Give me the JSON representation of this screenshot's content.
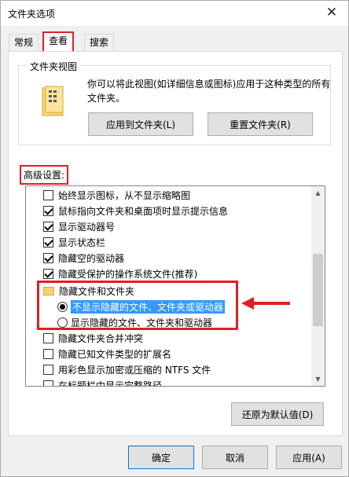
{
  "window": {
    "title": "文件夹选项",
    "close_glyph": "✕"
  },
  "tabs": [
    {
      "label": "常规"
    },
    {
      "label": "查看"
    },
    {
      "label": "搜索"
    }
  ],
  "folder_views": {
    "title": "文件夹视图",
    "description": "你可以将此视图(如详细信息或图标)应用于这种类型的所有文件夹。",
    "apply_button": "应用到文件夹(L)",
    "reset_button": "重置文件夹(R)"
  },
  "advanced": {
    "label": "高级设置:",
    "items": [
      {
        "label": "始终显示图标，从不显示缩略图",
        "type": "checkbox",
        "checked": false
      },
      {
        "label": "鼠标指向文件夹和桌面项时显示提示信息",
        "type": "checkbox",
        "checked": true
      },
      {
        "label": "显示驱动器号",
        "type": "checkbox",
        "checked": true
      },
      {
        "label": "显示状态栏",
        "type": "checkbox",
        "checked": true
      },
      {
        "label": "隐藏空的驱动器",
        "type": "checkbox",
        "checked": true
      },
      {
        "label": "隐藏受保护的操作系统文件(推荐)",
        "type": "checkbox",
        "checked": true
      },
      {
        "label": "隐藏文件和文件夹",
        "type": "folder"
      },
      {
        "label": "不显示隐藏的文件、文件夹或驱动器",
        "type": "radio",
        "checked": true
      },
      {
        "label": "显示隐藏的文件、文件夹和驱动器",
        "type": "radio",
        "checked": false
      },
      {
        "label": "隐藏文件夹合并冲突",
        "type": "checkbox",
        "checked": false
      },
      {
        "label": "隐藏已知文件类型的扩展名",
        "type": "checkbox",
        "checked": false
      },
      {
        "label": "用彩色显示加密或压缩的 NTFS 文件",
        "type": "checkbox",
        "checked": false
      },
      {
        "label": "在标题栏中显示完整路径",
        "type": "checkbox",
        "checked": false
      }
    ],
    "restore_button": "还原为默认值(D)"
  },
  "footer": {
    "ok": "确定",
    "cancel": "取消",
    "apply": "应用(A)"
  },
  "colors": {
    "annotation": "#e02020",
    "selection": "#3399ff"
  }
}
